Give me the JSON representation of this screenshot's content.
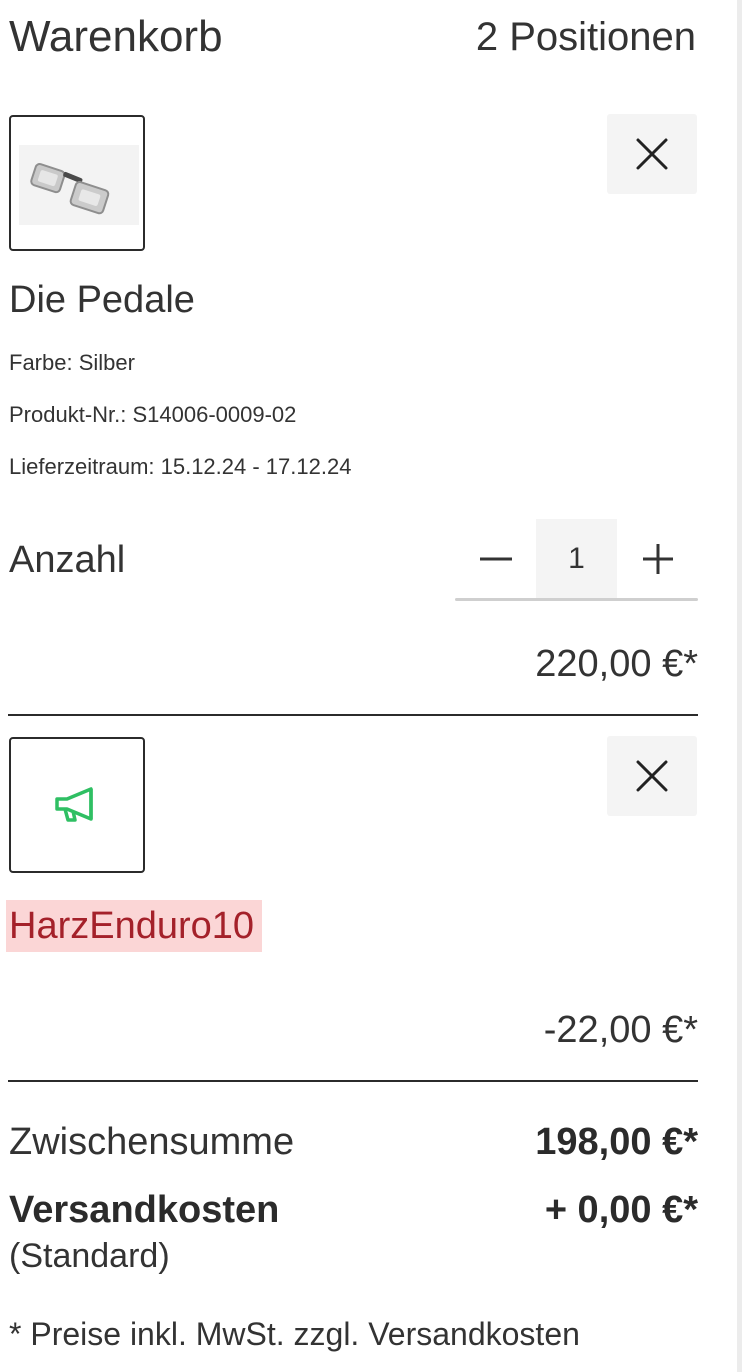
{
  "cart": {
    "title": "Warenkorb",
    "count_label": "2 Positionen"
  },
  "items": [
    {
      "name": "Die Pedale",
      "attributes": {
        "color": "Farbe: Silber",
        "product_number": "Produkt-Nr.: S14006-0009-02",
        "delivery": "Lieferzeitraum: 15.12.24 - 17.12.24"
      },
      "quantity_label": "Anzahl",
      "quantity": "1",
      "price": "220,00 €*",
      "image_icon": "pedals-product-image",
      "remove_icon": "close-icon"
    },
    {
      "name": "HarzEnduro10",
      "price": "-22,00 €*",
      "image_icon": "megaphone-icon",
      "remove_icon": "close-icon"
    }
  ],
  "summary": {
    "subtotal_label": "Zwischensumme",
    "subtotal_value": "198,00 €*",
    "shipping_label": "Versandkosten",
    "shipping_sub": "(Standard)",
    "shipping_value": "+ 0,00 €*"
  },
  "footnote": "* Preise inkl. MwSt. zzgl. Versandkosten",
  "colors": {
    "coupon_bg": "#fbd6d6",
    "coupon_text": "#a4212a",
    "megaphone": "#2fbf63",
    "button_bg": "#f4f4f4"
  }
}
